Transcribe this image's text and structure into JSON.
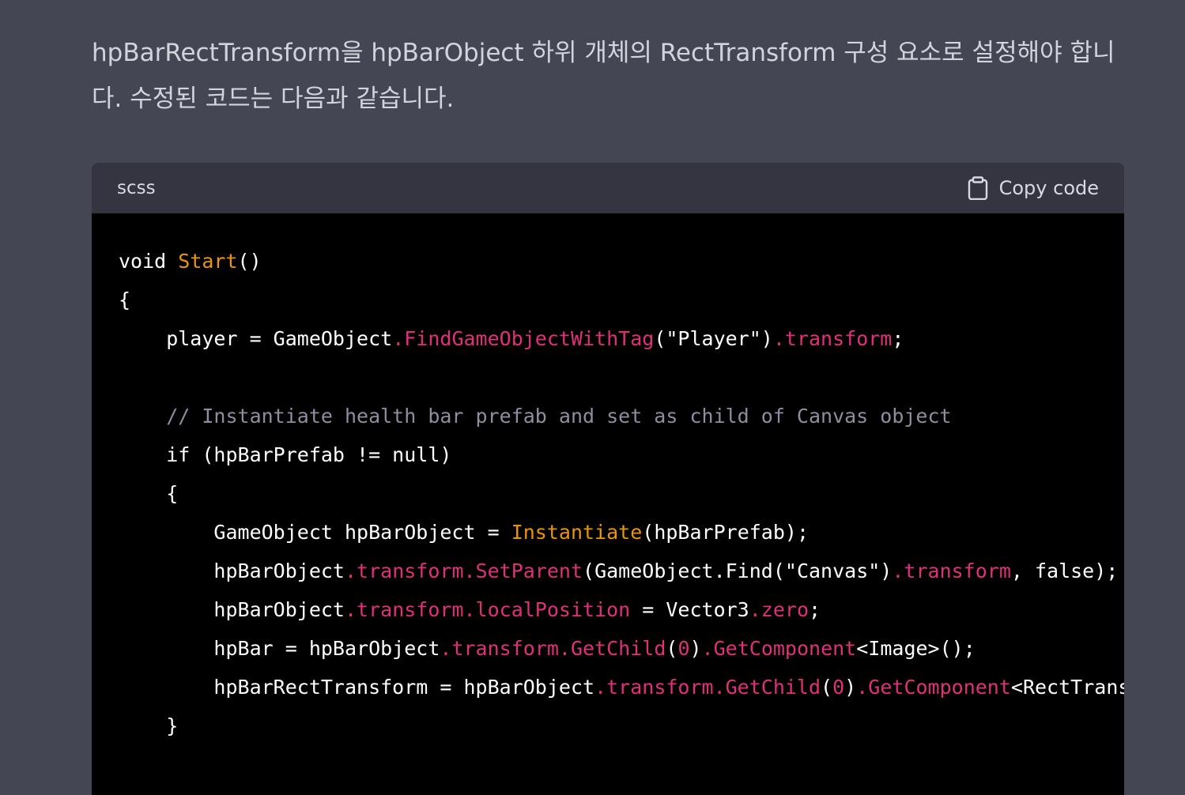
{
  "message": {
    "text": "hpBarRectTransform을 hpBarObject 하위 개체의 RectTransform 구성 요소로 설정해야 합니다. 수정된 코드는 다음과 같습니다."
  },
  "code_block": {
    "language": "scss",
    "copy_label": "Copy code",
    "copy_icon": "clipboard-icon",
    "colors": {
      "header_bg": "#343541",
      "body_bg": "#000000",
      "function": "#e9950c",
      "member": "#df3079",
      "comment": "#8e8ea0",
      "text": "#ffffff"
    },
    "lines": [
      [
        {
          "t": "void ",
          "c": "plain"
        },
        {
          "t": "Start",
          "c": "fn"
        },
        {
          "t": "()",
          "c": "plain"
        }
      ],
      [
        {
          "t": "{",
          "c": "plain"
        }
      ],
      [
        {
          "t": "    player = GameObject",
          "c": "plain"
        },
        {
          "t": ".FindGameObjectWithTag",
          "c": "mem"
        },
        {
          "t": "(\"Player\")",
          "c": "plain"
        },
        {
          "t": ".transform",
          "c": "mem"
        },
        {
          "t": ";",
          "c": "plain"
        }
      ],
      [
        {
          "t": "",
          "c": "plain"
        }
      ],
      [
        {
          "t": "    // Instantiate health bar prefab and set as child of Canvas object",
          "c": "comment"
        }
      ],
      [
        {
          "t": "    if (hpBarPrefab != null)",
          "c": "plain"
        }
      ],
      [
        {
          "t": "    {",
          "c": "plain"
        }
      ],
      [
        {
          "t": "        GameObject hpBarObject = ",
          "c": "plain"
        },
        {
          "t": "Instantiate",
          "c": "fn"
        },
        {
          "t": "(hpBarPrefab);",
          "c": "plain"
        }
      ],
      [
        {
          "t": "        hpBarObject",
          "c": "plain"
        },
        {
          "t": ".transform.SetParent",
          "c": "mem"
        },
        {
          "t": "(GameObject.Find(\"Canvas\")",
          "c": "plain"
        },
        {
          "t": ".transform",
          "c": "mem"
        },
        {
          "t": ", false);",
          "c": "plain"
        }
      ],
      [
        {
          "t": "        hpBarObject",
          "c": "plain"
        },
        {
          "t": ".transform.localPosition",
          "c": "mem"
        },
        {
          "t": " = Vector3",
          "c": "plain"
        },
        {
          "t": ".zero",
          "c": "mem"
        },
        {
          "t": ";",
          "c": "plain"
        }
      ],
      [
        {
          "t": "        hpBar = hpBarObject",
          "c": "plain"
        },
        {
          "t": ".transform.GetChild",
          "c": "mem"
        },
        {
          "t": "(",
          "c": "plain"
        },
        {
          "t": "0",
          "c": "mem"
        },
        {
          "t": ")",
          "c": "plain"
        },
        {
          "t": ".GetComponent",
          "c": "mem"
        },
        {
          "t": "<Image>();",
          "c": "plain"
        }
      ],
      [
        {
          "t": "        hpBarRectTransform = hpBarObject",
          "c": "plain"
        },
        {
          "t": ".transform.GetChild",
          "c": "mem"
        },
        {
          "t": "(",
          "c": "plain"
        },
        {
          "t": "0",
          "c": "mem"
        },
        {
          "t": ")",
          "c": "plain"
        },
        {
          "t": ".GetComponent",
          "c": "mem"
        },
        {
          "t": "<RectTransform>(",
          "c": "plain"
        }
      ],
      [
        {
          "t": "    }",
          "c": "plain"
        }
      ]
    ]
  }
}
